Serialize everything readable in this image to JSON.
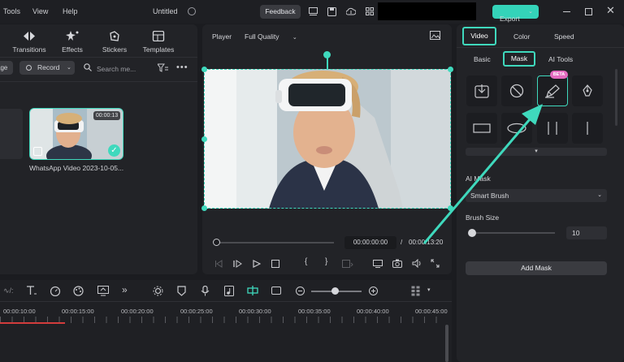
{
  "menubar": {
    "tools": "Tools",
    "view": "View",
    "help": "Help",
    "title": "Untitled",
    "feedback": "Feedback",
    "export": "Export"
  },
  "toolbar": {
    "transitions": "Transitions",
    "effects": "Effects",
    "stickers": "Stickers",
    "templates": "Templates"
  },
  "media_filter": {
    "left_partial": "age",
    "record": "Record",
    "search_placeholder": "Search me..."
  },
  "media": {
    "duration": "00:00:13",
    "name": "WhatsApp Video 2023-10-05..."
  },
  "player": {
    "label": "Player",
    "quality": "Full Quality",
    "current_time": "00:00:00:00",
    "separator": "/",
    "total_time": "00:00:13:20"
  },
  "right_panel": {
    "tabs": [
      "Video",
      "Color",
      "Speed"
    ],
    "subtabs": [
      "Basic",
      "Mask",
      "AI Tools"
    ],
    "beta": "BETA",
    "ai_mask_label": "AI Mask",
    "ai_mask_value": "Smart Brush",
    "brush_size_label": "Brush Size",
    "brush_size_value": "10",
    "add_mask": "Add Mask"
  },
  "timeline": {
    "ticks": [
      "00:00:10:00",
      "00:00:15:00",
      "00:00:20:00",
      "00:00:25:00",
      "00:00:30:00",
      "00:00:35:00",
      "00:00:40:00",
      "00:00:45:00"
    ]
  },
  "colors": {
    "accent": "#3fd9bd",
    "export_bg": "#34d3b9"
  }
}
